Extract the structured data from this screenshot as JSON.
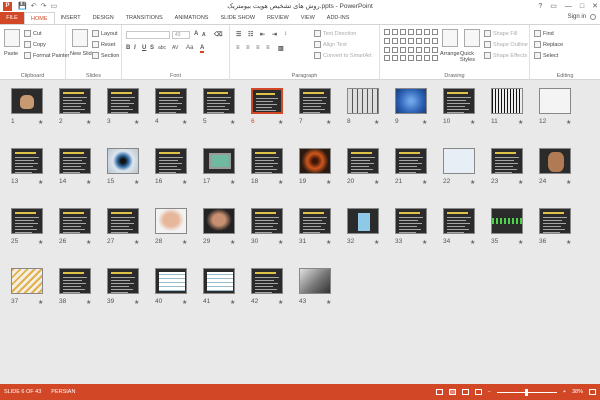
{
  "window": {
    "title": "روش های تشخیص هویت بیومتریک.ppts - PowerPoint",
    "controls": [
      "?",
      "▭",
      "—",
      "□",
      "✕"
    ]
  },
  "qat": [
    "💾",
    "↶",
    "↷",
    "▭"
  ],
  "tabs": {
    "file": "FILE",
    "items": [
      "HOME",
      "INSERT",
      "DESIGN",
      "TRANSITIONS",
      "ANIMATIONS",
      "SLIDE SHOW",
      "REVIEW",
      "VIEW",
      "ADD-INS"
    ],
    "active_index": 0
  },
  "signin": "Sign in",
  "ribbon": {
    "clipboard": {
      "label": "Clipboard",
      "paste": "Paste",
      "cut": "Cut",
      "copy": "Copy",
      "format_painter": "Format Painter"
    },
    "slides": {
      "label": "Slides",
      "new_slide": "New Slide",
      "layout": "Layout",
      "reset": "Reset",
      "section": "Section"
    },
    "font": {
      "label": "Font",
      "font_size": "43",
      "bold": "B",
      "italic": "I",
      "underline": "U",
      "strike": "S",
      "shadow": "abc",
      "spacing": "AV",
      "case": "Aa",
      "color": "A"
    },
    "paragraph": {
      "label": "Paragraph",
      "text_direction": "Text Direction",
      "align_text": "Align Text",
      "convert_smartart": "Convert to SmartArt"
    },
    "drawing": {
      "label": "Drawing",
      "arrange": "Arrange",
      "quick_styles": "Quick Styles",
      "shape_fill": "Shape Fill",
      "shape_outline": "Shape Outline",
      "shape_effects": "Shape Effects"
    },
    "editing": {
      "label": "Editing",
      "find": "Find",
      "replace": "Replace",
      "select": "Select"
    }
  },
  "slides": [
    {
      "n": "1",
      "pic": "hand"
    },
    {
      "n": "2"
    },
    {
      "n": "3"
    },
    {
      "n": "4"
    },
    {
      "n": "5"
    },
    {
      "n": "6",
      "selected": true
    },
    {
      "n": "7"
    },
    {
      "n": "8",
      "pic": "grid"
    },
    {
      "n": "9",
      "pic": "fingerprint"
    },
    {
      "n": "10"
    },
    {
      "n": "11",
      "pic": "barcode"
    },
    {
      "n": "12",
      "pic": "hand2"
    },
    {
      "n": "13"
    },
    {
      "n": "14"
    },
    {
      "n": "15",
      "pic": "eye"
    },
    {
      "n": "16"
    },
    {
      "n": "17",
      "pic": "monitor"
    },
    {
      "n": "18"
    },
    {
      "n": "19",
      "pic": "iris"
    },
    {
      "n": "20"
    },
    {
      "n": "21"
    },
    {
      "n": "22",
      "pic": "diagram"
    },
    {
      "n": "23"
    },
    {
      "n": "24",
      "pic": "palm"
    },
    {
      "n": "25"
    },
    {
      "n": "26"
    },
    {
      "n": "27"
    },
    {
      "n": "28",
      "pic": "face"
    },
    {
      "n": "29",
      "pic": "face2"
    },
    {
      "n": "30"
    },
    {
      "n": "31"
    },
    {
      "n": "32",
      "pic": "figure"
    },
    {
      "n": "33"
    },
    {
      "n": "34"
    },
    {
      "n": "35",
      "pic": "wave"
    },
    {
      "n": "36"
    },
    {
      "n": "37",
      "pic": "dna"
    },
    {
      "n": "38"
    },
    {
      "n": "39"
    },
    {
      "n": "40",
      "pic": "table"
    },
    {
      "n": "41",
      "pic": "table"
    },
    {
      "n": "42"
    },
    {
      "n": "43",
      "pic": "photo"
    }
  ],
  "star_glyph": "★",
  "status": {
    "slide_info": "SLIDE 6 OF 43",
    "language": "PERSIAN",
    "zoom": "38%",
    "zoom_minus": "−",
    "zoom_plus": "+"
  },
  "colors": {
    "accent": "#d24726",
    "slide_bg": "#2b2b2b",
    "slide_title": "#f2d24b"
  }
}
